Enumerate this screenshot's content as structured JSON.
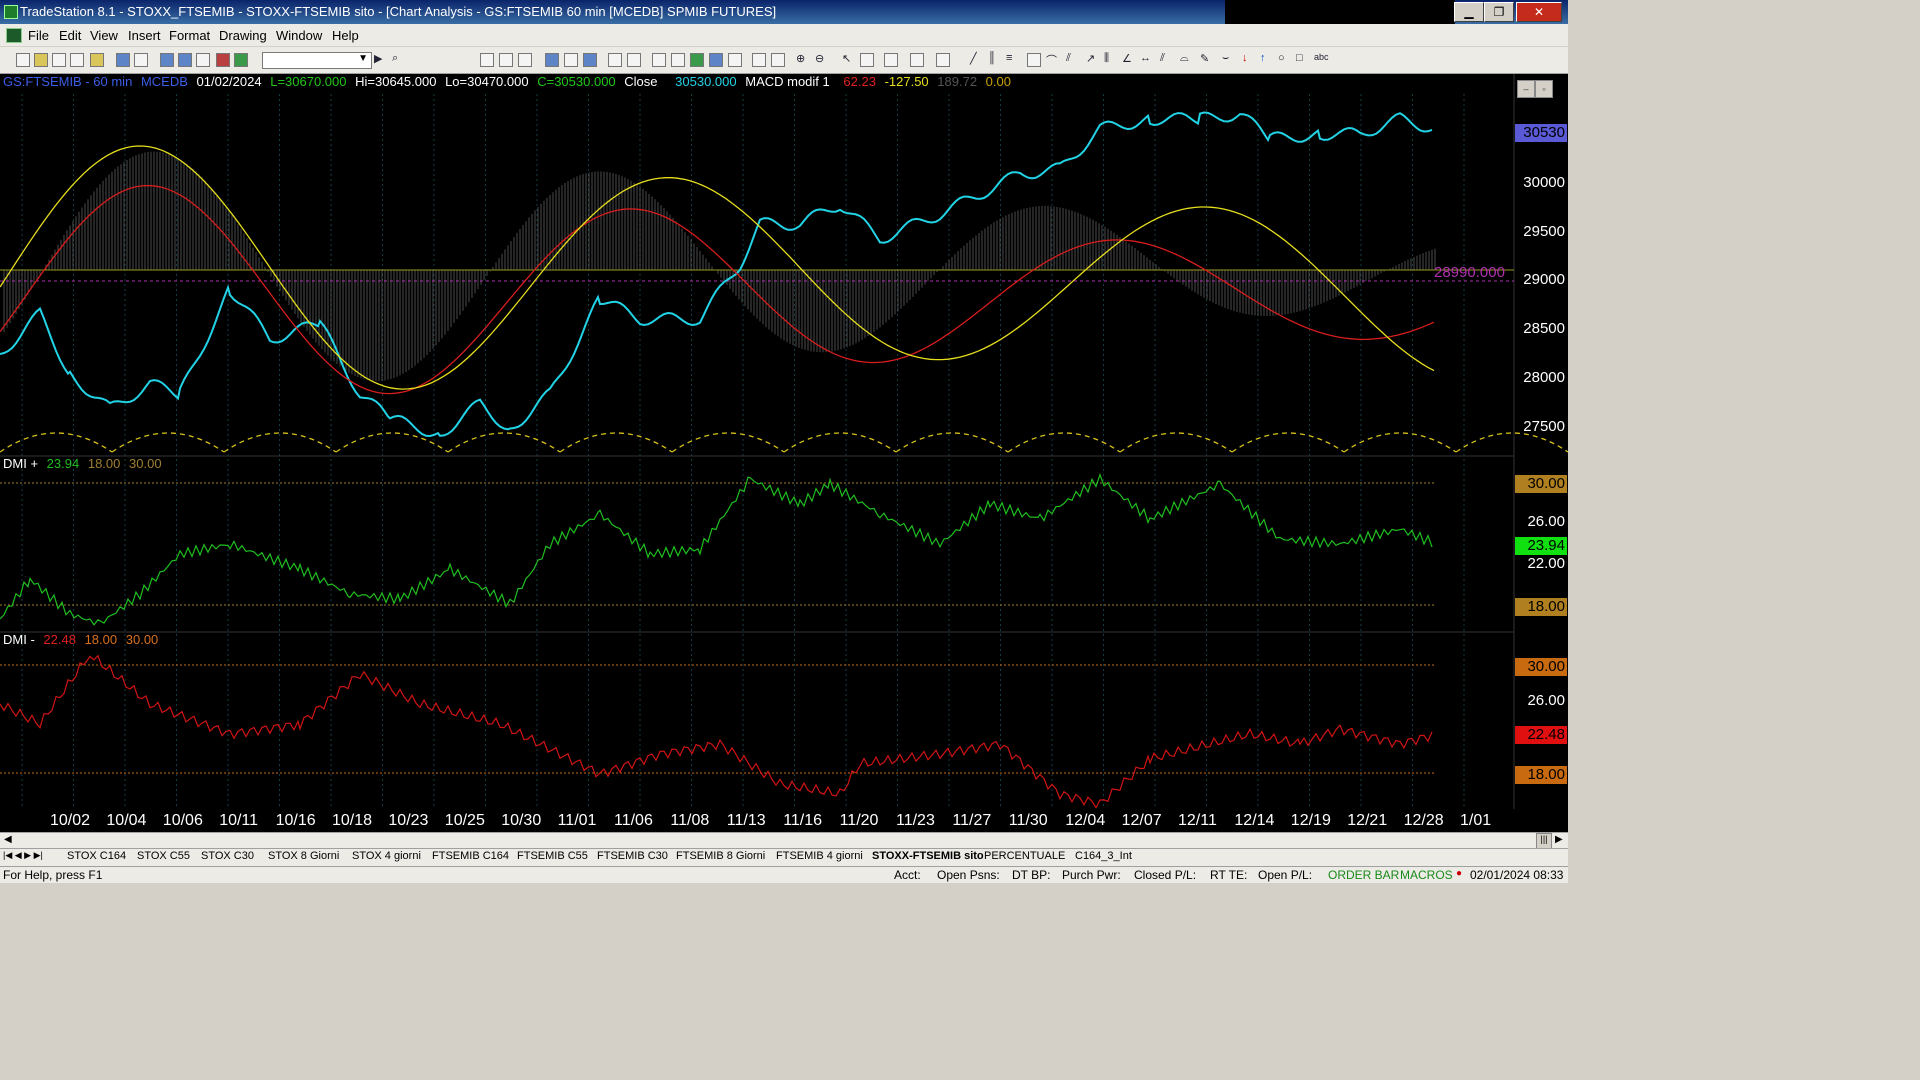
{
  "window": {
    "title": "TradeStation 8.1 - STOXX_FTSEMIB - STOXX-FTSEMIB sito - [Chart Analysis - GS:FTSEMIB  60 min  [MCEDB] SPMIB FUTURES]"
  },
  "menu": [
    "File",
    "Edit",
    "View",
    "Insert",
    "Format",
    "Drawing",
    "Window",
    "Help"
  ],
  "header": {
    "symbol": "GS:FTSEMIB - 60 min",
    "source": "MCEDB",
    "date": "01/02/2024",
    "low_val": "L=30670.000",
    "hi_val": "Hi=30645.000",
    "lo_val": "Lo=30470.000",
    "close_val": "C=30530.000",
    "close_label": "Close",
    "close_num": "30530.000",
    "indicator": "MACD modif 1",
    "v1": "62.23",
    "v2": "-127.50",
    "v3": "189.72",
    "v4": "0.00"
  },
  "price_axis": [
    "30000",
    "29500",
    "29000",
    "28500",
    "28000",
    "27500"
  ],
  "price_badge": "30530",
  "price_hline_label": "28990.000",
  "dmi_plus": {
    "label": "DMI +",
    "value": "23.94",
    "lvl1": "18.00",
    "lvl2": "30.00",
    "axis": [
      "30.00",
      "26.00",
      "22.00",
      "18.00"
    ],
    "badge": "23.94"
  },
  "dmi_minus": {
    "label": "DMI -",
    "value": "22.48",
    "lvl1": "18.00",
    "lvl2": "30.00",
    "axis": [
      "30.00",
      "26.00",
      "18.00"
    ],
    "badge": "22.48"
  },
  "dates": [
    "10/02",
    "10/04",
    "10/06",
    "10/11",
    "10/16",
    "10/18",
    "10/23",
    "10/25",
    "10/30",
    "11/01",
    "11/06",
    "11/08",
    "11/13",
    "11/16",
    "11/20",
    "11/23",
    "11/27",
    "11/30",
    "12/04",
    "12/07",
    "12/11",
    "12/14",
    "12/19",
    "12/21",
    "12/28",
    "1/01"
  ],
  "tabs": [
    "STOX C164",
    "STOX C55",
    "STOX  C30",
    "STOX  8 Giorni",
    "STOX 4 giorni",
    "FTSEMIB C164",
    "FTSEMIB C55",
    "FTSEMIB C30",
    "FTSEMIB  8 Giorni",
    "FTSEMIB  4 giorni",
    "STOXX-FTSEMIB sito",
    "PERCENTUALE",
    "C164_3_Int"
  ],
  "status": {
    "help": "For Help, press F1",
    "acct": "Acct:",
    "open_psns": "Open Psns:",
    "dt_bp": "DT BP:",
    "purch_pwr": "Purch Pwr:",
    "closed_pl": "Closed P/L:",
    "rt_te": "RT TE:",
    "open_pl": "Open P/L:",
    "order_bar": "ORDER BAR",
    "macros": "MACROS",
    "datetime": "02/01/2024 08:33"
  },
  "colors": {
    "price": "#22d3e6",
    "macd_red": "#d81d1d",
    "macd_yellow": "#e6dd1d",
    "dmi_plus": "#1fbf1f",
    "dmi_minus": "#d21414",
    "histogram": "#8a8a8a"
  }
}
